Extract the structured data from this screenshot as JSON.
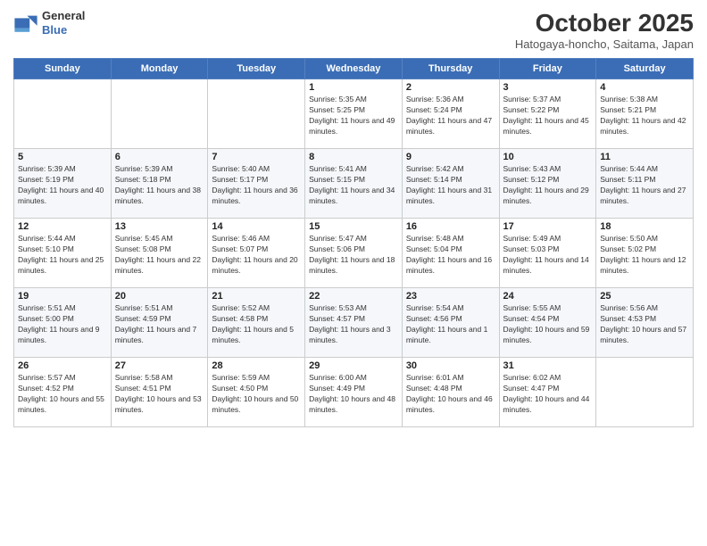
{
  "header": {
    "logo_line1": "General",
    "logo_line2": "Blue",
    "month": "October 2025",
    "location": "Hatogaya-honcho, Saitama, Japan"
  },
  "weekdays": [
    "Sunday",
    "Monday",
    "Tuesday",
    "Wednesday",
    "Thursday",
    "Friday",
    "Saturday"
  ],
  "weeks": [
    [
      {
        "day": "",
        "info": ""
      },
      {
        "day": "",
        "info": ""
      },
      {
        "day": "",
        "info": ""
      },
      {
        "day": "1",
        "info": "Sunrise: 5:35 AM\nSunset: 5:25 PM\nDaylight: 11 hours and 49 minutes."
      },
      {
        "day": "2",
        "info": "Sunrise: 5:36 AM\nSunset: 5:24 PM\nDaylight: 11 hours and 47 minutes."
      },
      {
        "day": "3",
        "info": "Sunrise: 5:37 AM\nSunset: 5:22 PM\nDaylight: 11 hours and 45 minutes."
      },
      {
        "day": "4",
        "info": "Sunrise: 5:38 AM\nSunset: 5:21 PM\nDaylight: 11 hours and 42 minutes."
      }
    ],
    [
      {
        "day": "5",
        "info": "Sunrise: 5:39 AM\nSunset: 5:19 PM\nDaylight: 11 hours and 40 minutes."
      },
      {
        "day": "6",
        "info": "Sunrise: 5:39 AM\nSunset: 5:18 PM\nDaylight: 11 hours and 38 minutes."
      },
      {
        "day": "7",
        "info": "Sunrise: 5:40 AM\nSunset: 5:17 PM\nDaylight: 11 hours and 36 minutes."
      },
      {
        "day": "8",
        "info": "Sunrise: 5:41 AM\nSunset: 5:15 PM\nDaylight: 11 hours and 34 minutes."
      },
      {
        "day": "9",
        "info": "Sunrise: 5:42 AM\nSunset: 5:14 PM\nDaylight: 11 hours and 31 minutes."
      },
      {
        "day": "10",
        "info": "Sunrise: 5:43 AM\nSunset: 5:12 PM\nDaylight: 11 hours and 29 minutes."
      },
      {
        "day": "11",
        "info": "Sunrise: 5:44 AM\nSunset: 5:11 PM\nDaylight: 11 hours and 27 minutes."
      }
    ],
    [
      {
        "day": "12",
        "info": "Sunrise: 5:44 AM\nSunset: 5:10 PM\nDaylight: 11 hours and 25 minutes."
      },
      {
        "day": "13",
        "info": "Sunrise: 5:45 AM\nSunset: 5:08 PM\nDaylight: 11 hours and 22 minutes."
      },
      {
        "day": "14",
        "info": "Sunrise: 5:46 AM\nSunset: 5:07 PM\nDaylight: 11 hours and 20 minutes."
      },
      {
        "day": "15",
        "info": "Sunrise: 5:47 AM\nSunset: 5:06 PM\nDaylight: 11 hours and 18 minutes."
      },
      {
        "day": "16",
        "info": "Sunrise: 5:48 AM\nSunset: 5:04 PM\nDaylight: 11 hours and 16 minutes."
      },
      {
        "day": "17",
        "info": "Sunrise: 5:49 AM\nSunset: 5:03 PM\nDaylight: 11 hours and 14 minutes."
      },
      {
        "day": "18",
        "info": "Sunrise: 5:50 AM\nSunset: 5:02 PM\nDaylight: 11 hours and 12 minutes."
      }
    ],
    [
      {
        "day": "19",
        "info": "Sunrise: 5:51 AM\nSunset: 5:00 PM\nDaylight: 11 hours and 9 minutes."
      },
      {
        "day": "20",
        "info": "Sunrise: 5:51 AM\nSunset: 4:59 PM\nDaylight: 11 hours and 7 minutes."
      },
      {
        "day": "21",
        "info": "Sunrise: 5:52 AM\nSunset: 4:58 PM\nDaylight: 11 hours and 5 minutes."
      },
      {
        "day": "22",
        "info": "Sunrise: 5:53 AM\nSunset: 4:57 PM\nDaylight: 11 hours and 3 minutes."
      },
      {
        "day": "23",
        "info": "Sunrise: 5:54 AM\nSunset: 4:56 PM\nDaylight: 11 hours and 1 minute."
      },
      {
        "day": "24",
        "info": "Sunrise: 5:55 AM\nSunset: 4:54 PM\nDaylight: 10 hours and 59 minutes."
      },
      {
        "day": "25",
        "info": "Sunrise: 5:56 AM\nSunset: 4:53 PM\nDaylight: 10 hours and 57 minutes."
      }
    ],
    [
      {
        "day": "26",
        "info": "Sunrise: 5:57 AM\nSunset: 4:52 PM\nDaylight: 10 hours and 55 minutes."
      },
      {
        "day": "27",
        "info": "Sunrise: 5:58 AM\nSunset: 4:51 PM\nDaylight: 10 hours and 53 minutes."
      },
      {
        "day": "28",
        "info": "Sunrise: 5:59 AM\nSunset: 4:50 PM\nDaylight: 10 hours and 50 minutes."
      },
      {
        "day": "29",
        "info": "Sunrise: 6:00 AM\nSunset: 4:49 PM\nDaylight: 10 hours and 48 minutes."
      },
      {
        "day": "30",
        "info": "Sunrise: 6:01 AM\nSunset: 4:48 PM\nDaylight: 10 hours and 46 minutes."
      },
      {
        "day": "31",
        "info": "Sunrise: 6:02 AM\nSunset: 4:47 PM\nDaylight: 10 hours and 44 minutes."
      },
      {
        "day": "",
        "info": ""
      }
    ]
  ]
}
